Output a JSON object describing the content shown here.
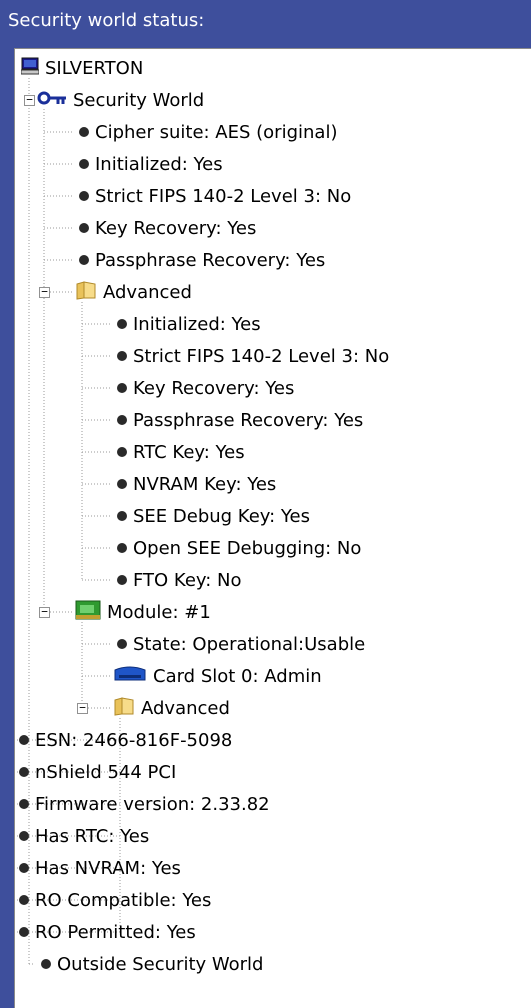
{
  "window": {
    "title": "Security world status:"
  },
  "tree": {
    "root": {
      "label": "SILVERTON",
      "icon": "computer-icon"
    },
    "security_world": {
      "label": "Security World",
      "icon": "key-icon",
      "expander": "minus",
      "items": [
        "Cipher suite: AES (original)",
        "Initialized: Yes",
        "Strict FIPS 140-2 Level 3: No",
        "Key Recovery: Yes",
        "Passphrase Recovery: Yes"
      ],
      "advanced": {
        "label": "Advanced",
        "icon": "folder-icon",
        "expander": "minus",
        "items": [
          "Initialized: Yes",
          "Strict FIPS 140-2 Level 3: No",
          "Key Recovery: Yes",
          "Passphrase Recovery: Yes",
          "RTC Key: Yes",
          "NVRAM Key: Yes",
          "SEE Debug Key: Yes",
          "Open SEE Debugging: No",
          "FTO Key: No"
        ]
      },
      "module": {
        "label": "Module: #1",
        "icon": "module-icon",
        "expander": "minus",
        "state": "State: Operational:Usable",
        "card_slot": "Card Slot  0: Admin",
        "card_slot_icon": "card-slot-icon",
        "advanced": {
          "label": "Advanced",
          "icon": "folder-icon",
          "expander": "minus",
          "items": [
            "ESN: 2466-816F-5098",
            "nShield 544 PCI",
            "Firmware version: 2.33.82",
            "Has RTC: Yes",
            "Has NVRAM: Yes",
            "RO Compatible: Yes",
            "RO Permitted: Yes"
          ]
        }
      }
    },
    "outside": {
      "label": "Outside Security World"
    }
  },
  "colors": {
    "frame": "#3e4f9c",
    "background": "#ffffff",
    "text": "#000000",
    "guide": "#9a9a9a"
  }
}
